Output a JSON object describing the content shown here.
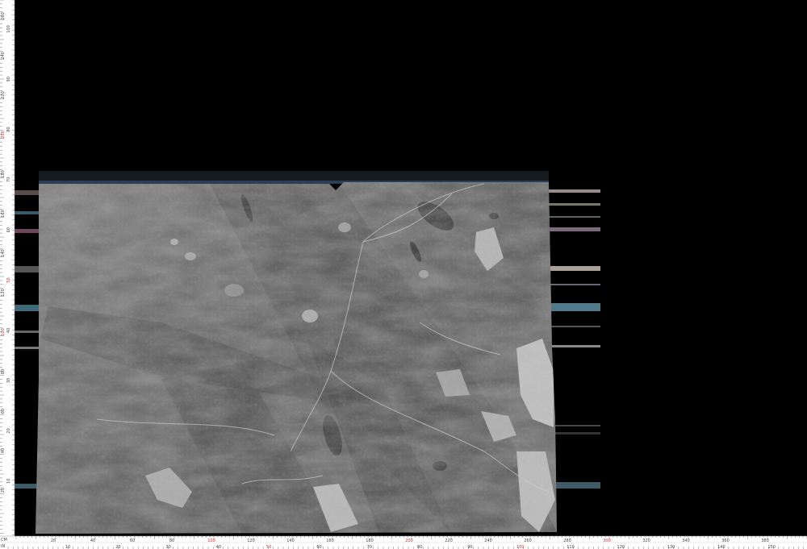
{
  "ruler": {
    "bottom_cm_labels": [
      "20",
      "40",
      "60",
      "80",
      "100",
      "120",
      "140",
      "160",
      "180",
      "200",
      "220",
      "240",
      "260",
      "280",
      "300",
      "320",
      "340",
      "360",
      "380"
    ],
    "bottom_cm_highlight": [
      "100",
      "200",
      "300"
    ],
    "bottom_in_labels": [
      "10",
      "20",
      "30",
      "40",
      "50",
      "60",
      "70",
      "80",
      "90",
      "100",
      "110",
      "120",
      "130",
      "140",
      "150"
    ],
    "bottom_in_highlight": [
      "50",
      "100"
    ],
    "left_cm_labels": [
      "260",
      "240",
      "220",
      "200",
      "180",
      "160",
      "140",
      "120",
      "100",
      "80",
      "60",
      "40",
      "20"
    ],
    "left_cm_highlight": [
      "200",
      "100"
    ],
    "left_in_labels": [
      "100",
      "90",
      "80",
      "70",
      "60",
      "50",
      "40",
      "30",
      "20",
      "10"
    ],
    "left_in_highlight": [
      "50"
    ],
    "corner_top": "CM",
    "corner_bottom": "IN"
  },
  "slab": {
    "subject": "grey marble slab",
    "colors": {
      "base": "#6e6e6e",
      "dark": "#3e3e3e",
      "light": "#b9b9b9",
      "veins": "#d2d2d2"
    }
  }
}
